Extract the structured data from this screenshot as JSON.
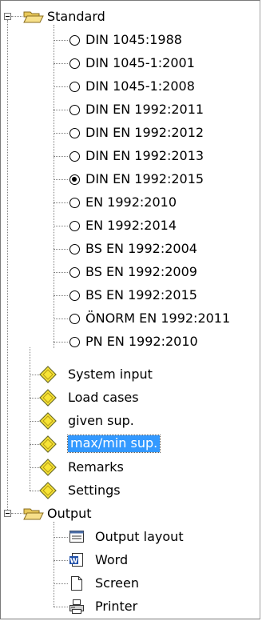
{
  "tree": {
    "standard_label": "Standard",
    "standards": [
      {
        "label": "DIN 1045:1988",
        "selected": false
      },
      {
        "label": "DIN 1045-1:2001",
        "selected": false
      },
      {
        "label": "DIN 1045-1:2008",
        "selected": false
      },
      {
        "label": "DIN EN 1992:2011",
        "selected": false
      },
      {
        "label": "DIN EN 1992:2012",
        "selected": false
      },
      {
        "label": "DIN EN 1992:2013",
        "selected": false
      },
      {
        "label": "DIN EN 1992:2015",
        "selected": true
      },
      {
        "label": "EN 1992:2010",
        "selected": false
      },
      {
        "label": "EN 1992:2014",
        "selected": false
      },
      {
        "label": "BS EN 1992:2004",
        "selected": false
      },
      {
        "label": "BS EN 1992:2009",
        "selected": false
      },
      {
        "label": "BS EN 1992:2015",
        "selected": false
      },
      {
        "label": "ÖNORM EN 1992:2011",
        "selected": false
      },
      {
        "label": "PN EN 1992:2010",
        "selected": false
      }
    ],
    "items": [
      {
        "label": "System input",
        "icon": "diamond-icon",
        "selected": false
      },
      {
        "label": "Load cases",
        "icon": "diamond-icon",
        "selected": false
      },
      {
        "label": "given sup.",
        "icon": "diamond-icon",
        "selected": false
      },
      {
        "label": "max/min sup.",
        "icon": "diamond-icon",
        "selected": true
      },
      {
        "label": "Remarks",
        "icon": "diamond-icon",
        "selected": false
      },
      {
        "label": "Settings",
        "icon": "diamond-icon",
        "selected": false
      }
    ],
    "output_label": "Output",
    "outputs": [
      {
        "label": "Output layout",
        "icon": "output-layout-icon"
      },
      {
        "label": "Word",
        "icon": "word-icon"
      },
      {
        "label": "Screen",
        "icon": "screen-icon"
      },
      {
        "label": "Printer",
        "icon": "printer-icon"
      }
    ]
  },
  "colors": {
    "selection": "#3399ff",
    "diamond": "#f7e436",
    "folder": "#f2dc76"
  }
}
